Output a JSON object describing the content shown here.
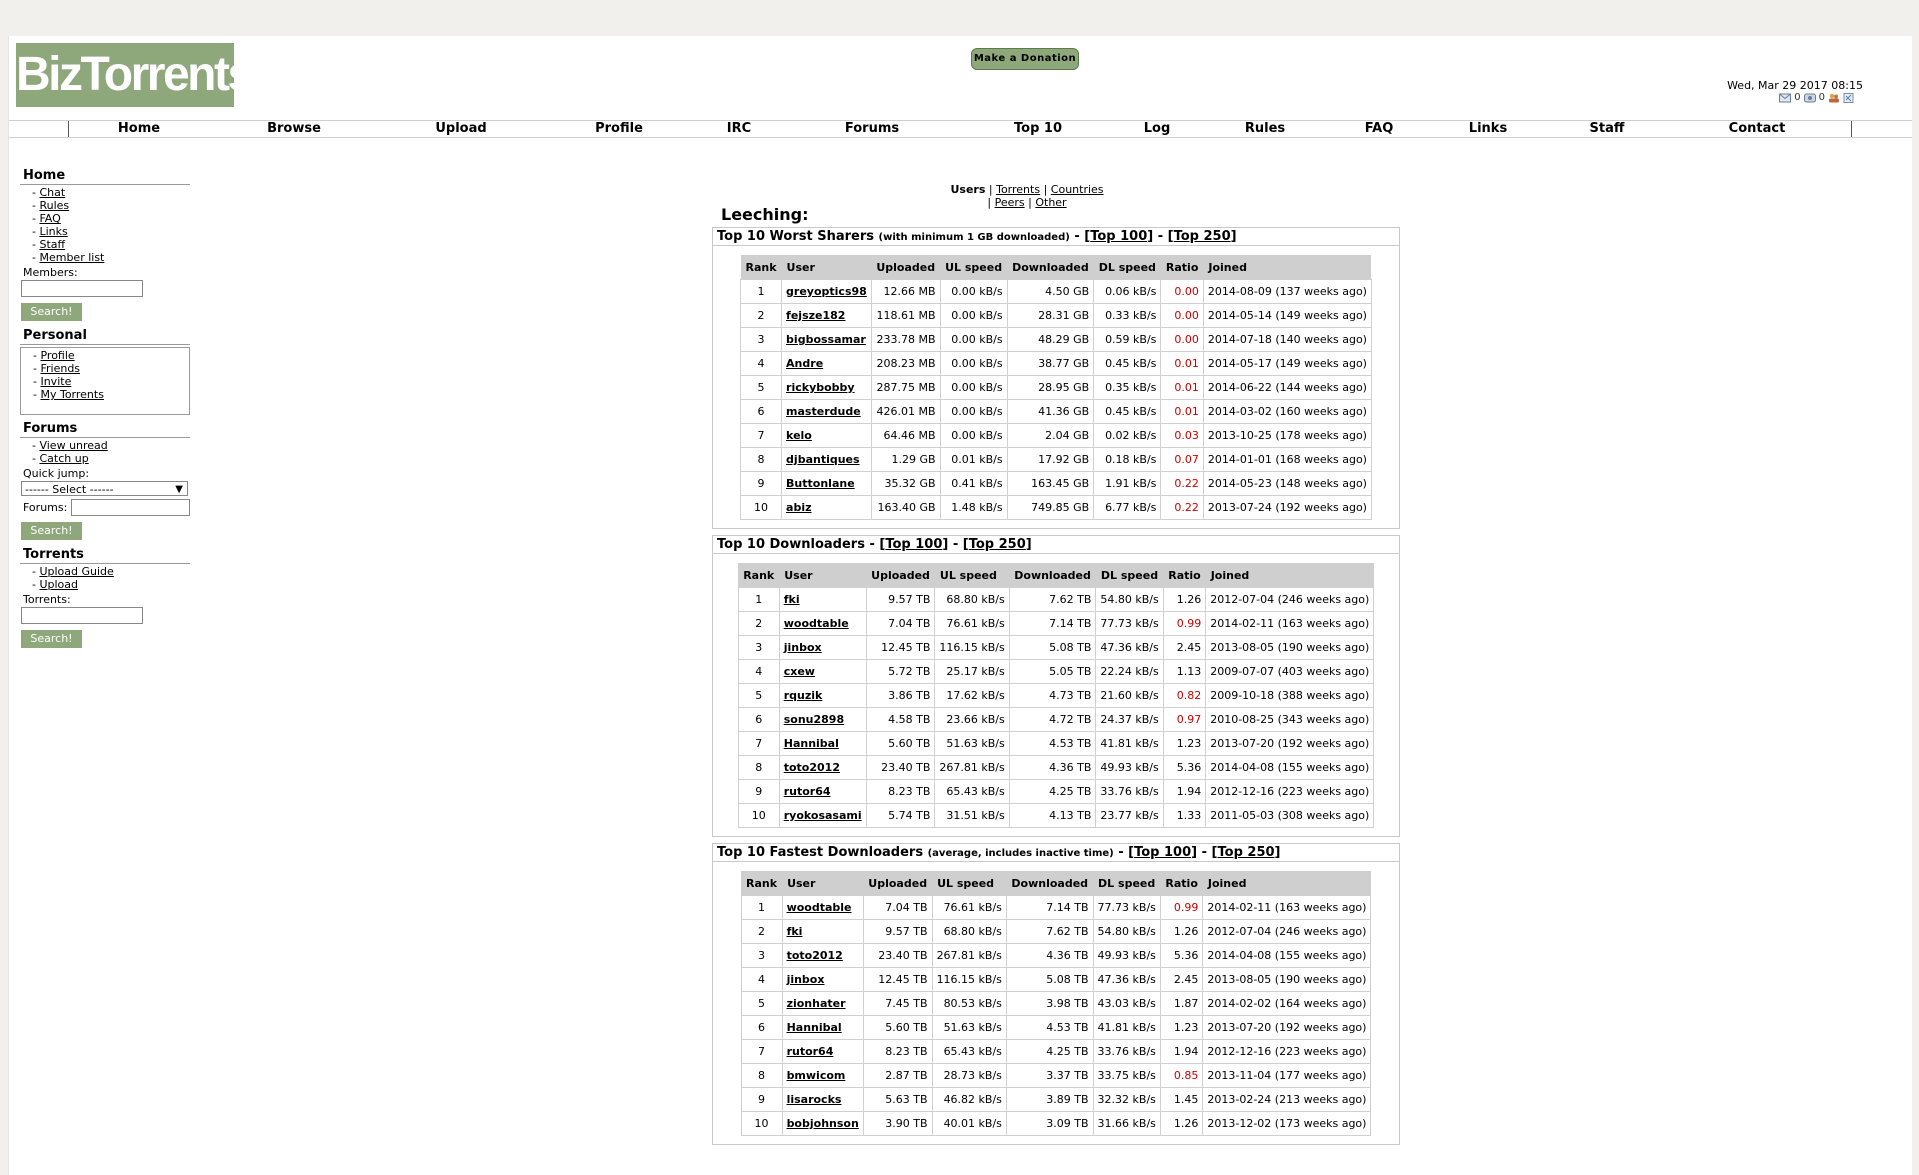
{
  "logo": "BizTorrents",
  "donate_label": "Make a Donation",
  "datetime": "Wed, Mar 29 2017 08:15",
  "status": {
    "messages": "0",
    "invites": "0"
  },
  "nav": [
    "Home",
    "Browse",
    "Upload",
    "Profile",
    "IRC",
    "Forums",
    "Top 10",
    "Log",
    "Rules",
    "FAQ",
    "Links",
    "Staff",
    "Contact"
  ],
  "sidebar": {
    "home": {
      "title": "Home",
      "links": [
        "Chat",
        "Rules",
        "FAQ",
        "Links",
        "Staff",
        "Member list"
      ],
      "label": "Members:",
      "button": "Search!"
    },
    "personal": {
      "title": "Personal",
      "links": [
        "Profile",
        "Friends",
        "Invite",
        "My Torrents"
      ]
    },
    "forums": {
      "title": "Forums",
      "links": [
        "View unread",
        "Catch up"
      ],
      "quick_jump": "Quick jump:",
      "select": "------ Select ------",
      "label": "Forums:",
      "button": "Search!"
    },
    "torrents": {
      "title": "Torrents",
      "links": [
        "Upload Guide",
        "Upload"
      ],
      "label": "Torrents:",
      "button": "Search!"
    }
  },
  "subnav": {
    "active": "Users",
    "links": [
      "Torrents",
      "Countries",
      "Peers",
      "Other"
    ]
  },
  "main": {
    "heading": "Leeching:",
    "columns": [
      "Rank",
      "User",
      "Uploaded",
      "UL speed",
      "Downloaded",
      "DL speed",
      "Ratio",
      "Joined"
    ],
    "sections": [
      {
        "title": "Top 10 Worst Sharers",
        "note": "(with minimum 1 GB downloaded)",
        "top100": "Top 100",
        "top250": "Top 250",
        "rows": [
          [
            "1",
            "greyoptics98",
            "12.66 MB",
            "0.00 kB/s",
            "4.50 GB",
            "0.06 kB/s",
            "0.00",
            "2014-08-09 (137 weeks ago)"
          ],
          [
            "2",
            "fejsze182",
            "118.61 MB",
            "0.00 kB/s",
            "28.31 GB",
            "0.33 kB/s",
            "0.00",
            "2014-05-14 (149 weeks ago)"
          ],
          [
            "3",
            "bigbossamar",
            "233.78 MB",
            "0.00 kB/s",
            "48.29 GB",
            "0.59 kB/s",
            "0.00",
            "2014-07-18 (140 weeks ago)"
          ],
          [
            "4",
            "Andre",
            "208.23 MB",
            "0.00 kB/s",
            "38.77 GB",
            "0.45 kB/s",
            "0.01",
            "2014-05-17 (149 weeks ago)"
          ],
          [
            "5",
            "rickybobby",
            "287.75 MB",
            "0.00 kB/s",
            "28.95 GB",
            "0.35 kB/s",
            "0.01",
            "2014-06-22 (144 weeks ago)"
          ],
          [
            "6",
            "masterdude",
            "426.01 MB",
            "0.00 kB/s",
            "41.36 GB",
            "0.45 kB/s",
            "0.01",
            "2014-03-02 (160 weeks ago)"
          ],
          [
            "7",
            "kelo",
            "64.46 MB",
            "0.00 kB/s",
            "2.04 GB",
            "0.02 kB/s",
            "0.03",
            "2013-10-25 (178 weeks ago)"
          ],
          [
            "8",
            "djbantiques",
            "1.29 GB",
            "0.01 kB/s",
            "17.92 GB",
            "0.18 kB/s",
            "0.07",
            "2014-01-01 (168 weeks ago)"
          ],
          [
            "9",
            "Buttonlane",
            "35.32 GB",
            "0.41 kB/s",
            "163.45 GB",
            "1.91 kB/s",
            "0.22",
            "2014-05-23 (148 weeks ago)"
          ],
          [
            "10",
            "abiz",
            "163.40 GB",
            "1.48 kB/s",
            "749.85 GB",
            "6.77 kB/s",
            "0.22",
            "2013-07-24 (192 weeks ago)"
          ]
        ]
      },
      {
        "title": "Top 10 Downloaders",
        "note": "",
        "top100": "Top 100",
        "top250": "Top 250",
        "rows": [
          [
            "1",
            "fki",
            "9.57 TB",
            "68.80 kB/s",
            "7.62 TB",
            "54.80 kB/s",
            "1.26",
            "2012-07-04 (246 weeks ago)"
          ],
          [
            "2",
            "woodtable",
            "7.04 TB",
            "76.61 kB/s",
            "7.14 TB",
            "77.73 kB/s",
            "0.99",
            "2014-02-11 (163 weeks ago)"
          ],
          [
            "3",
            "jinbox",
            "12.45 TB",
            "116.15 kB/s",
            "5.08 TB",
            "47.36 kB/s",
            "2.45",
            "2013-08-05 (190 weeks ago)"
          ],
          [
            "4",
            "cxew",
            "5.72 TB",
            "25.17 kB/s",
            "5.05 TB",
            "22.24 kB/s",
            "1.13",
            "2009-07-07 (403 weeks ago)"
          ],
          [
            "5",
            "rquzik",
            "3.86 TB",
            "17.62 kB/s",
            "4.73 TB",
            "21.60 kB/s",
            "0.82",
            "2009-10-18 (388 weeks ago)"
          ],
          [
            "6",
            "sonu2898",
            "4.58 TB",
            "23.66 kB/s",
            "4.72 TB",
            "24.37 kB/s",
            "0.97",
            "2010-08-25 (343 weeks ago)"
          ],
          [
            "7",
            "Hannibal",
            "5.60 TB",
            "51.63 kB/s",
            "4.53 TB",
            "41.81 kB/s",
            "1.23",
            "2013-07-20 (192 weeks ago)"
          ],
          [
            "8",
            "toto2012",
            "23.40 TB",
            "267.81 kB/s",
            "4.36 TB",
            "49.93 kB/s",
            "5.36",
            "2014-04-08 (155 weeks ago)"
          ],
          [
            "9",
            "rutor64",
            "8.23 TB",
            "65.43 kB/s",
            "4.25 TB",
            "33.76 kB/s",
            "1.94",
            "2012-12-16 (223 weeks ago)"
          ],
          [
            "10",
            "ryokosasami",
            "5.74 TB",
            "31.51 kB/s",
            "4.13 TB",
            "23.77 kB/s",
            "1.33",
            "2011-05-03 (308 weeks ago)"
          ]
        ]
      },
      {
        "title": "Top 10 Fastest Downloaders",
        "note": "(average, includes inactive time)",
        "top100": "Top 100",
        "top250": "Top 250",
        "rows": [
          [
            "1",
            "woodtable",
            "7.04 TB",
            "76.61 kB/s",
            "7.14 TB",
            "77.73 kB/s",
            "0.99",
            "2014-02-11 (163 weeks ago)"
          ],
          [
            "2",
            "fki",
            "9.57 TB",
            "68.80 kB/s",
            "7.62 TB",
            "54.80 kB/s",
            "1.26",
            "2012-07-04 (246 weeks ago)"
          ],
          [
            "3",
            "toto2012",
            "23.40 TB",
            "267.81 kB/s",
            "4.36 TB",
            "49.93 kB/s",
            "5.36",
            "2014-04-08 (155 weeks ago)"
          ],
          [
            "4",
            "jinbox",
            "12.45 TB",
            "116.15 kB/s",
            "5.08 TB",
            "47.36 kB/s",
            "2.45",
            "2013-08-05 (190 weeks ago)"
          ],
          [
            "5",
            "zionhater",
            "7.45 TB",
            "80.53 kB/s",
            "3.98 TB",
            "43.03 kB/s",
            "1.87",
            "2014-02-02 (164 weeks ago)"
          ],
          [
            "6",
            "Hannibal",
            "5.60 TB",
            "51.63 kB/s",
            "4.53 TB",
            "41.81 kB/s",
            "1.23",
            "2013-07-20 (192 weeks ago)"
          ],
          [
            "7",
            "rutor64",
            "8.23 TB",
            "65.43 kB/s",
            "4.25 TB",
            "33.76 kB/s",
            "1.94",
            "2012-12-16 (223 weeks ago)"
          ],
          [
            "8",
            "bmwicom",
            "2.87 TB",
            "28.73 kB/s",
            "3.37 TB",
            "33.75 kB/s",
            "0.85",
            "2013-11-04 (177 weeks ago)"
          ],
          [
            "9",
            "lisarocks",
            "5.63 TB",
            "46.82 kB/s",
            "3.89 TB",
            "32.32 kB/s",
            "1.45",
            "2013-02-24 (213 weeks ago)"
          ],
          [
            "10",
            "bobjohnson",
            "3.90 TB",
            "40.01 kB/s",
            "3.09 TB",
            "31.66 kB/s",
            "1.26",
            "2013-12-02 (173 weeks ago)"
          ]
        ]
      }
    ]
  },
  "colors": {
    "brand": "#8ea77b",
    "low_ratio": "#cc0000"
  }
}
